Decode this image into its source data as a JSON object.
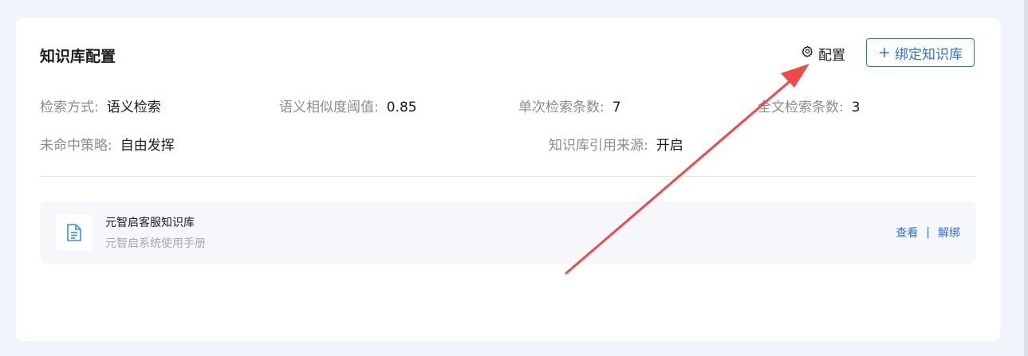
{
  "card": {
    "title": "知识库配置",
    "config_label": "配置",
    "bind_label": "绑定知识库",
    "bind_icon": "plus-icon",
    "config_icon": "gear-icon"
  },
  "settings": {
    "search_mode": {
      "label": "检索方式:",
      "value": "语义检索"
    },
    "similarity_threshold": {
      "label": "语义相似度阈值:",
      "value": "0.85"
    },
    "single_count": {
      "label": "单次检索条数:",
      "value": "7"
    },
    "fulltext_count": {
      "label": "全文检索条数:",
      "value": "3"
    },
    "miss_strategy": {
      "label": "未命中策略:",
      "value": "自由发挥"
    },
    "citation_source": {
      "label": "知识库引用来源:",
      "value": "开启"
    }
  },
  "knowledge_bases": [
    {
      "name": "元智启客服知识库",
      "description": "元智启系统使用手册",
      "view_label": "查看",
      "separator": "|",
      "unbind_label": "解绑",
      "icon": "document-icon"
    }
  ],
  "colors": {
    "accent": "#2f6ee0",
    "annotation_arrow": "#ef4a4a",
    "background": "#f1f4fb"
  }
}
